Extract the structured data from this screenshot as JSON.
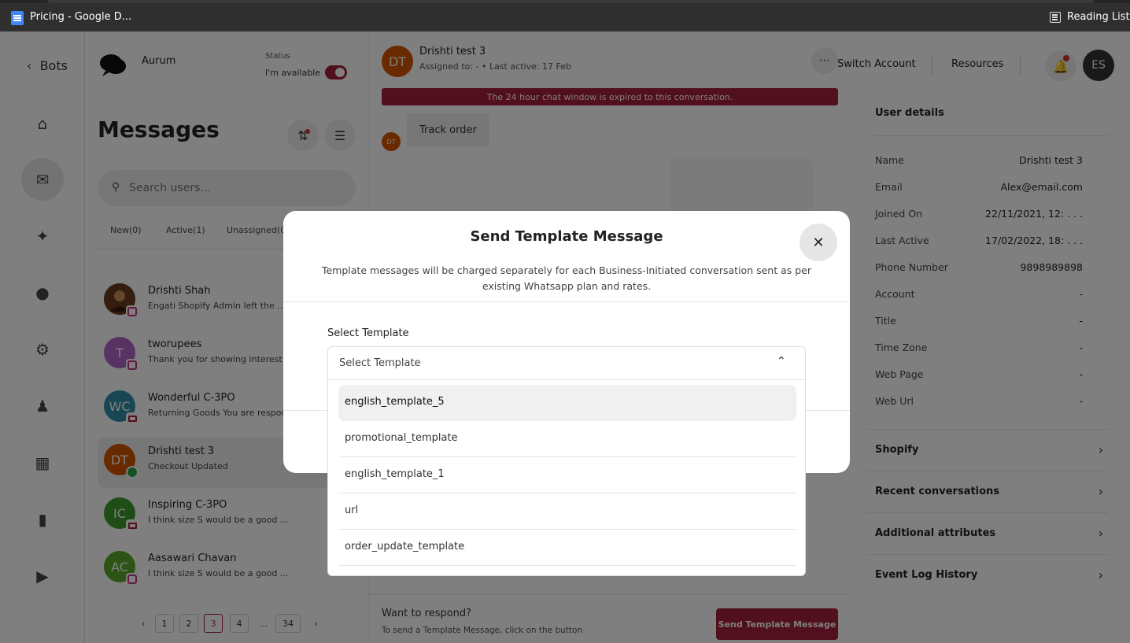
{
  "browser": {
    "tab_title": "Pricing - Google D...",
    "reading_list": "Reading List"
  },
  "sidebar": {
    "back_label": "Bots",
    "icons": [
      "home-icon",
      "messages-icon",
      "flows-icon",
      "idea-icon",
      "settings-icon",
      "users-icon",
      "integrations-icon",
      "analytics-icon",
      "broadcast-icon"
    ]
  },
  "bot": {
    "name": "Aurum",
    "status_label": "Status",
    "availability": "I'm available"
  },
  "messages": {
    "title": "Messages",
    "search_placeholder": "Search users...",
    "tabs": [
      "New(0)",
      "Active(1)",
      "Unassigned(0)"
    ],
    "conversations": [
      {
        "initials": "",
        "name": "Drishti Shah",
        "preview": "Engati Shopify Admin left the ...",
        "channel": "instagram",
        "avatar_color": "#8b4a2b"
      },
      {
        "initials": "T",
        "name": "tworupees",
        "preview": "Thank you for showing interest ...",
        "channel": "instagram",
        "avatar_color": "#b264c9"
      },
      {
        "initials": "WC",
        "name": "Wonderful C-3PO",
        "preview": "Returning Goods You are respon",
        "channel": "web",
        "avatar_color": "#2e8fa8"
      },
      {
        "initials": "DT",
        "name": "Drishti test 3",
        "preview": "Checkout Updated",
        "channel": "whatsapp",
        "avatar_color": "#d35400"
      },
      {
        "initials": "IC",
        "name": "Inspiring C-3PO",
        "preview": "I think size S would be a good ...",
        "channel": "web",
        "avatar_color": "#3f9b2b"
      },
      {
        "initials": "AC",
        "name": "Aasawari Chavan",
        "preview": "I think size S would be a good ...",
        "channel": "instagram",
        "avatar_color": "#5aa82a"
      }
    ],
    "pagination": [
      "1",
      "2",
      "3",
      "4",
      "...",
      "34"
    ],
    "current_page": "3"
  },
  "chat": {
    "initials": "DT",
    "name": "Drishti test 3",
    "subtitle": "Assigned to: - • Last active: 17 Feb",
    "banner": "The 24 hour chat window is expired to this conversation.",
    "message_initials": "DT",
    "message": "Track order",
    "respond_title": "Want to respond?",
    "respond_sub": "To send a Template Message, click on the button",
    "send_button": "Send Template Message"
  },
  "topnav": {
    "switch_account": "Switch Account",
    "resources": "Resources",
    "profile_initials": "ES"
  },
  "user_details": {
    "title": "User details",
    "fields": [
      {
        "key": "Name",
        "value": "Drishti test 3"
      },
      {
        "key": "Email",
        "value": "Alex@email.com"
      },
      {
        "key": "Joined On",
        "value": "22/11/2021, 12: . . ."
      },
      {
        "key": "Last Active",
        "value": "17/02/2022, 18: . . ."
      },
      {
        "key": "Phone Number",
        "value": "9898989898"
      },
      {
        "key": "Account",
        "value": "-"
      },
      {
        "key": "Title",
        "value": "-"
      },
      {
        "key": "Time Zone",
        "value": "-"
      },
      {
        "key": "Web Page",
        "value": "-"
      },
      {
        "key": "Web Url",
        "value": "-"
      }
    ],
    "sections": [
      "Shopify",
      "Recent conversations",
      "Additional attributes",
      "Event Log History"
    ]
  },
  "modal": {
    "title": "Send Template Message",
    "description": "Template messages will be charged separately for each Business-Initiated conversation sent as per existing Whatsapp plan and rates.",
    "select_label": "Select Template",
    "select_placeholder": "Select Template",
    "options": [
      "english_template_5",
      "promotional_template",
      "english_template_1",
      "url",
      "order_update_template"
    ],
    "highlighted_option": "english_template_5"
  },
  "colors": {
    "brand": "#a41e3b",
    "overlay": "rgba(0,0,0,0.5)"
  }
}
